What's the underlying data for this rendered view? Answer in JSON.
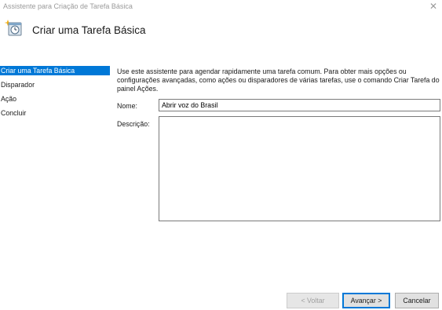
{
  "window": {
    "title": "Assistente para Criação de Tarefa Básica",
    "close_glyph": "✕"
  },
  "header": {
    "title": "Criar uma Tarefa Básica",
    "icon": "scheduled-task-clock-icon"
  },
  "nav": {
    "items": [
      {
        "label": "Criar uma Tarefa Básica",
        "active": true
      },
      {
        "label": "Disparador",
        "active": false
      },
      {
        "label": "Ação",
        "active": false
      },
      {
        "label": "Concluir",
        "active": false
      }
    ]
  },
  "main": {
    "intro": "Use este assistente para agendar rapidamente uma tarefa comum. Para obter mais opções ou configurações avançadas, como ações ou disparadores de várias tarefas, use o comando Criar Tarefa do painel Ações.",
    "name_label": "Nome:",
    "name_value": "Abrir voz do Brasil",
    "description_label": "Descrição:",
    "description_value": ""
  },
  "buttons": {
    "back": "< Voltar",
    "next": "Avançar >",
    "cancel": "Cancelar"
  },
  "colors": {
    "accent": "#0078d7",
    "title_text": "#9a9a9a"
  }
}
